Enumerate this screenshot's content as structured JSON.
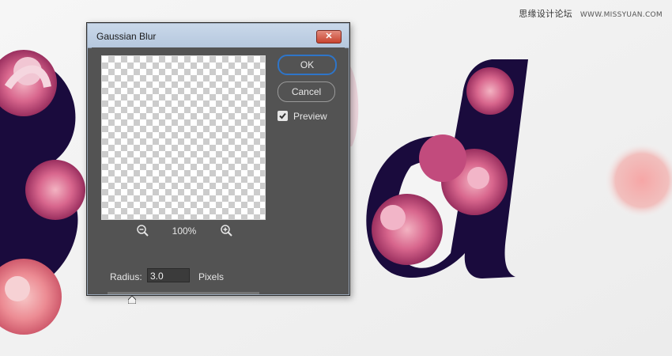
{
  "watermark": {
    "site_name": "思缘设计论坛",
    "url": "WWW.MISSYUAN.COM"
  },
  "dialog": {
    "title": "Gaussian Blur",
    "close_icon": "close-icon",
    "zoom_level": "100%",
    "zoom_out_icon": "zoom-out-icon",
    "zoom_in_icon": "zoom-in-icon",
    "radius_label": "Radius:",
    "radius_value": "3.0",
    "radius_unit": "Pixels",
    "slider_fraction": 0.16,
    "ok_label": "OK",
    "cancel_label": "Cancel",
    "preview_label": "Preview",
    "preview_checked": true
  },
  "colors": {
    "dialog_bg": "#535353",
    "ok_border": "#2e75c9",
    "close_button": "#c8442f",
    "letter_fill": "#1a0b3d",
    "rose_pink": "#d66a8f"
  }
}
